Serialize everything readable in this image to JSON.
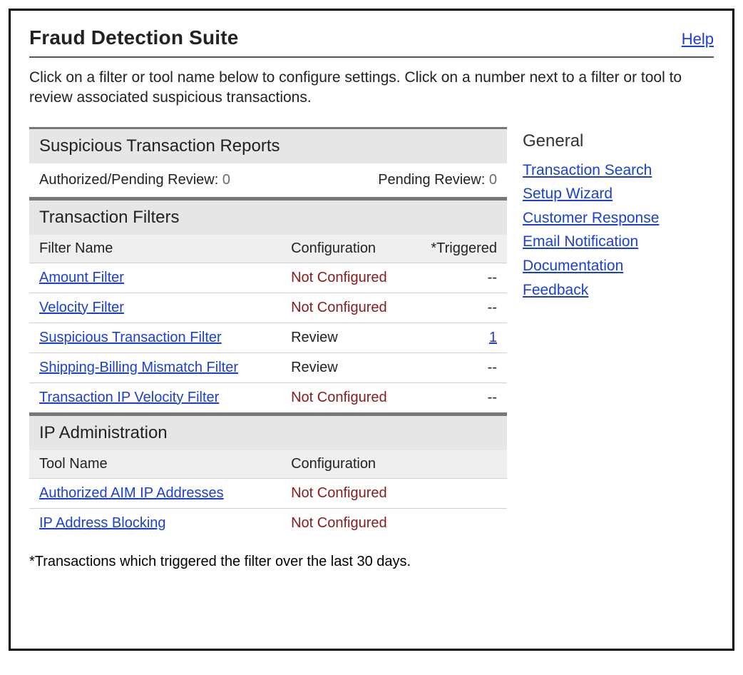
{
  "header": {
    "title": "Fraud Detection Suite",
    "help": "Help"
  },
  "intro": "Click on a filter or tool name below to configure settings. Click on a number next to a filter or tool to review associated suspicious transactions.",
  "reports": {
    "section_title": "Suspicious Transaction Reports",
    "auth_pending_label": "Authorized/Pending Review:",
    "auth_pending_value": "0",
    "pending_label": "Pending Review:",
    "pending_value": "0"
  },
  "filters": {
    "section_title": "Transaction Filters",
    "col_name": "Filter Name",
    "col_config": "Configuration",
    "col_trig": "*Triggered",
    "rows": [
      {
        "name": "Amount Filter",
        "config": "Not Configured",
        "config_class": "nc",
        "triggered": "--",
        "trig_link": false
      },
      {
        "name": "Velocity Filter",
        "config": "Not Configured",
        "config_class": "nc",
        "triggered": "--",
        "trig_link": false
      },
      {
        "name": "Suspicious Transaction Filter",
        "config": "Review",
        "config_class": "",
        "triggered": "1",
        "trig_link": true
      },
      {
        "name": "Shipping-Billing Mismatch Filter",
        "config": "Review",
        "config_class": "",
        "triggered": "--",
        "trig_link": false
      },
      {
        "name": "Transaction IP Velocity Filter",
        "config": "Not Configured",
        "config_class": "nc",
        "triggered": "--",
        "trig_link": false
      }
    ]
  },
  "ip_admin": {
    "section_title": "IP Administration",
    "col_name": "Tool Name",
    "col_config": "Configuration",
    "rows": [
      {
        "name": "Authorized AIM IP Addresses",
        "config": "Not Configured",
        "config_class": "nc"
      },
      {
        "name": "IP Address Blocking",
        "config": "Not Configured",
        "config_class": "nc"
      }
    ]
  },
  "footnote": "*Transactions which triggered the filter over the last 30 days.",
  "sidebar": {
    "heading": "General",
    "links": [
      "Transaction Search",
      "Setup Wizard",
      "Customer Response",
      "Email Notification",
      "Documentation",
      "Feedback"
    ]
  }
}
